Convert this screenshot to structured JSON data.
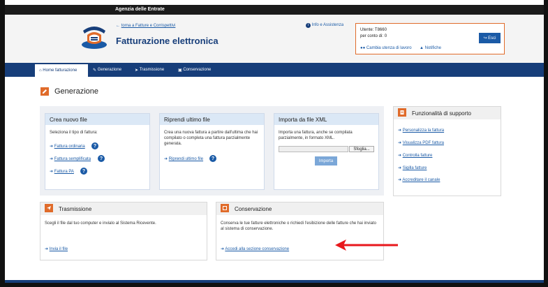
{
  "topbar": {
    "brand": "Agenzia delle Entrate"
  },
  "header": {
    "back_link": "torna a Fatture e Corrispettivi",
    "title": "Fatturazione elettronica",
    "info_link": "Info e Assistenza"
  },
  "userbox": {
    "user": "Utente: T8660",
    "conto": "per conto di: 0",
    "cambia": "Cambia utenza di lavoro",
    "notifiche": "Notifiche",
    "esci": "Esci"
  },
  "nav": {
    "items": [
      {
        "label": "Home fatturazione"
      },
      {
        "label": "Generazione"
      },
      {
        "label": "Trasmissione"
      },
      {
        "label": "Conservazione"
      }
    ]
  },
  "page": {
    "title": "Generazione"
  },
  "crea": {
    "title": "Crea nuovo file",
    "subtitle": "Seleziona il tipo di fattura:",
    "links": [
      "Fattura ordinaria",
      "Fattura semplificata",
      "Fattura PA"
    ]
  },
  "riprendi": {
    "title": "Riprendi ultimo file",
    "desc": "Crea una nuova fattura a partire dall'ultima che hai compilato o completa una fattura parzialmente generata.",
    "link": "Riprendi ultimo file"
  },
  "importa": {
    "title": "Importa da file XML",
    "desc": "Importa una fattura, anche se compilata parzialmente, in formato XML.",
    "browse": "Sfoglia...",
    "button": "Importa"
  },
  "supporto": {
    "title": "Funzionalità di supporto",
    "links": [
      "Personalizza la fattura",
      "Visualizza PDF fattura",
      "Controlla fatture",
      "Sigilla fatture",
      "Accreditare il canale"
    ]
  },
  "trasmissione": {
    "title": "Trasmissione",
    "desc": "Scegli il file dal tuo computer e invialo al Sistema Ricevente.",
    "link": "Invia il file"
  },
  "conservazione": {
    "title": "Conservazione",
    "desc": "Conserva le tue fatture elettroniche o richiedi l'esibizione delle fatture che hai inviato al sistema di conservazione.",
    "link": "Accedi alla sezione conservazione"
  },
  "colors": {
    "brand_blue": "#173e7a",
    "accent_orange": "#e06b2a",
    "link_blue": "#1a5aa6",
    "arrow_red": "#e8181c"
  }
}
